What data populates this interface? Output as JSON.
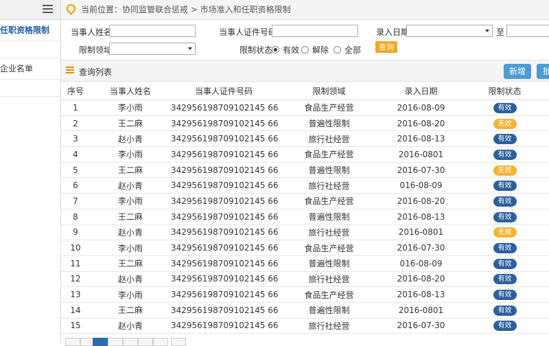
{
  "sidebar": {
    "items": [
      {
        "label": "任职资格限制"
      },
      {
        "label": "企业名单"
      }
    ]
  },
  "breadcrumb": {
    "text": "当前位置：协同监管联合惩戒 > 市场准入和任职资格限制"
  },
  "search": {
    "name_label": "当事人姓名",
    "id_label": "当事人证件号码",
    "date_label": "录入日期",
    "to_label": "至",
    "domain_label": "限制领域",
    "status_label": "限制状态",
    "status_options": [
      {
        "label": "有效",
        "selected": true
      },
      {
        "label": "解除",
        "selected": false
      },
      {
        "label": "全部",
        "selected": false
      }
    ],
    "query_button": "查询"
  },
  "list": {
    "title": "查询列表",
    "add_button": "新增",
    "batch_button": "批"
  },
  "table": {
    "headers": [
      "序号",
      "当事人姓名",
      "当事人证件号码",
      "限制领域",
      "录入日期",
      "限制状态"
    ],
    "rows": [
      {
        "no": "1",
        "name": "李小雨",
        "id": "342956198709102145 66",
        "domain": "食品生产经营",
        "date": "2016-08-09",
        "status": "有效",
        "status_type": "valid"
      },
      {
        "no": "2",
        "name": "王二麻",
        "id": "342956198709102145 66",
        "domain": "普遍性限制",
        "date": "2016-08-20",
        "status": "无效",
        "status_type": "invalid"
      },
      {
        "no": "3",
        "name": "赵小青",
        "id": "342956198709102145 66",
        "domain": "旅行社经营",
        "date": "2016-08-13",
        "status": "有效",
        "status_type": "valid"
      },
      {
        "no": "4",
        "name": "李小雨",
        "id": "342956198709102145 66",
        "domain": "食品生产经营",
        "date": "2016-0801",
        "status": "有效",
        "status_type": "valid"
      },
      {
        "no": "5",
        "name": "王二麻",
        "id": "342956198709102145 66",
        "domain": "普遍性限制",
        "date": "2016-07-30",
        "status": "无效",
        "status_type": "invalid"
      },
      {
        "no": "6",
        "name": "赵小青",
        "id": "342956198709102145 66",
        "domain": "旅行社经营",
        "date": "016-08-09",
        "status": "有效",
        "status_type": "valid"
      },
      {
        "no": "7",
        "name": "李小雨",
        "id": "342956198709102145 66",
        "domain": "食品生产经营",
        "date": "2016-08-20",
        "status": "有效",
        "status_type": "valid"
      },
      {
        "no": "8",
        "name": "王二麻",
        "id": "342956198709102145 66",
        "domain": "普遍性限制",
        "date": "2016-08-13",
        "status": "有效",
        "status_type": "valid"
      },
      {
        "no": "9",
        "name": "赵小青",
        "id": "342956198709102145 66",
        "domain": "旅行社经营",
        "date": "2016-0801",
        "status": "无效",
        "status_type": "invalid"
      },
      {
        "no": "10",
        "name": "李小雨",
        "id": "342956198709102145 66",
        "domain": "食品生产经营",
        "date": "2016-07-30",
        "status": "有效",
        "status_type": "valid"
      },
      {
        "no": "11",
        "name": "王二麻",
        "id": "342956198709102145 66",
        "domain": "普遍性限制",
        "date": "016-08-09",
        "status": "有效",
        "status_type": "valid"
      },
      {
        "no": "12",
        "name": "赵小青",
        "id": "342956198709102145 66",
        "domain": "旅行社经营",
        "date": "2016-08-20",
        "status": "有效",
        "status_type": "valid"
      },
      {
        "no": "13",
        "name": "李小雨",
        "id": "342956198709102145 66",
        "domain": "食品生产经营",
        "date": "2016-08-13",
        "status": "有效",
        "status_type": "valid"
      },
      {
        "no": "14",
        "name": "王二麻",
        "id": "342956198709102145 66",
        "domain": "普遍性限制",
        "date": "2016-0801",
        "status": "有效",
        "status_type": "valid"
      },
      {
        "no": "15",
        "name": "赵小青",
        "id": "342956198709102145 66",
        "domain": "旅行社经营",
        "date": "2016-07-30",
        "status": "有效",
        "status_type": "valid"
      }
    ]
  },
  "colors": {
    "valid": "#2c5f9e",
    "invalid": "#f5b335",
    "accent": "#4e9bd4",
    "query": "#f5a623"
  }
}
